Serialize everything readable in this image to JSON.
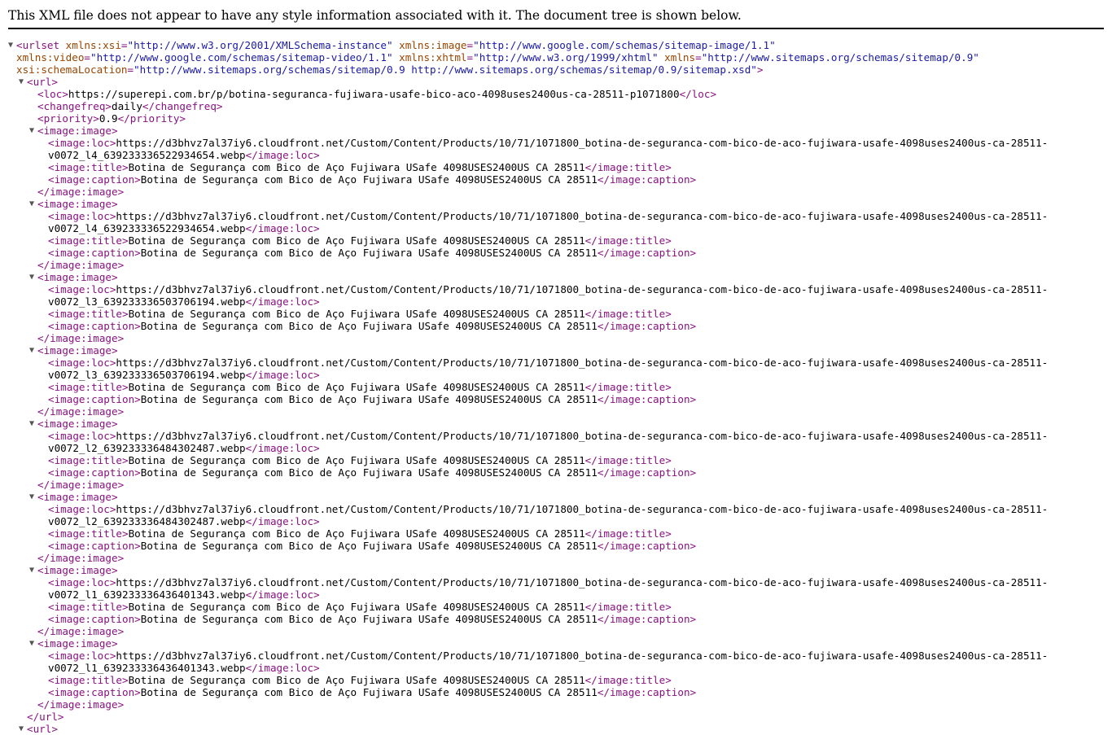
{
  "header": {
    "notice": "This XML file does not appear to have any style information associated with it. The document tree is shown below."
  },
  "icons": {
    "expanded": "▼",
    "expanded_icon_name": "disclosure-triangle-down-icon"
  },
  "colors": {
    "tag": "#881280",
    "attr_name": "#994500",
    "attr_value": "#1a1aa6",
    "text": "#000000"
  },
  "tree": {
    "urlset_open": {
      "tag": "<urlset",
      "attrs": [
        {
          "name": " xmlns:xsi",
          "eq": "=",
          "value": "\"http://www.w3.org/2001/XMLSchema-instance\""
        },
        {
          "name": " xmlns:image",
          "eq": "=",
          "value": "\"http://www.google.com/schemas/sitemap-image/1.1\""
        },
        {
          "name": "xmlns:video",
          "eq": "=",
          "value": "\"http://www.google.com/schemas/sitemap-video/1.1\""
        },
        {
          "name": " xmlns:xhtml",
          "eq": "=",
          "value": "\"http://www.w3.org/1999/xhtml\""
        },
        {
          "name": " xmlns",
          "eq": "=",
          "value": "\"http://www.sitemaps.org/schemas/sitemap/0.9\""
        },
        {
          "name": "xsi:schemaLocation",
          "eq": "=",
          "value": "\"http://www.sitemaps.org/schemas/sitemap/0.9 http://www.sitemaps.org/schemas/sitemap/0.9/sitemap.xsd\""
        }
      ],
      "close": ">"
    },
    "url_open": "<url>",
    "url_close": "</url>",
    "loc": {
      "open": "<loc>",
      "value": "https://superepi.com.br/p/botina-seguranca-fujiwara-usafe-bico-aco-4098uses2400us-ca-28511-p1071800",
      "close": "</loc>"
    },
    "changefreq": {
      "open": "<changefreq>",
      "value": "daily",
      "close": "</changefreq>"
    },
    "priority": {
      "open": "<priority>",
      "value": "0.9",
      "close": "</priority>"
    },
    "image_tags": {
      "open": "<image:image>",
      "close": "</image:image>",
      "loc_open": "<image:loc>",
      "loc_close": "</image:loc>",
      "title_open": "<image:title>",
      "title_close": "</image:title>",
      "caption_open": "<image:caption>",
      "caption_close": "</image:caption>"
    },
    "images": [
      {
        "loc_1": "https://d3bhvz7al37iy6.cloudfront.net/Custom/Content/Products/10/71/1071800_botina-de-seguranca-com-bico-de-aco-fujiwara-usafe-4098uses2400us-ca-28511-",
        "loc_2": "v0072_l4_639233336522934654.webp",
        "title": "Botina de Segurança com Bico de Aço Fujiwara USafe 4098USES2400US CA 28511",
        "caption": "Botina de Segurança com Bico de Aço Fujiwara USafe 4098USES2400US CA 28511"
      },
      {
        "loc_1": "https://d3bhvz7al37iy6.cloudfront.net/Custom/Content/Products/10/71/1071800_botina-de-seguranca-com-bico-de-aco-fujiwara-usafe-4098uses2400us-ca-28511-",
        "loc_2": "v0072_l4_639233336522934654.webp",
        "title": "Botina de Segurança com Bico de Aço Fujiwara USafe 4098USES2400US CA 28511",
        "caption": "Botina de Segurança com Bico de Aço Fujiwara USafe 4098USES2400US CA 28511"
      },
      {
        "loc_1": "https://d3bhvz7al37iy6.cloudfront.net/Custom/Content/Products/10/71/1071800_botina-de-seguranca-com-bico-de-aco-fujiwara-usafe-4098uses2400us-ca-28511-",
        "loc_2": "v0072_l3_639233336503706194.webp",
        "title": "Botina de Segurança com Bico de Aço Fujiwara USafe 4098USES2400US CA 28511",
        "caption": "Botina de Segurança com Bico de Aço Fujiwara USafe 4098USES2400US CA 28511"
      },
      {
        "loc_1": "https://d3bhvz7al37iy6.cloudfront.net/Custom/Content/Products/10/71/1071800_botina-de-seguranca-com-bico-de-aco-fujiwara-usafe-4098uses2400us-ca-28511-",
        "loc_2": "v0072_l3_639233336503706194.webp",
        "title": "Botina de Segurança com Bico de Aço Fujiwara USafe 4098USES2400US CA 28511",
        "caption": "Botina de Segurança com Bico de Aço Fujiwara USafe 4098USES2400US CA 28511"
      },
      {
        "loc_1": "https://d3bhvz7al37iy6.cloudfront.net/Custom/Content/Products/10/71/1071800_botina-de-seguranca-com-bico-de-aco-fujiwara-usafe-4098uses2400us-ca-28511-",
        "loc_2": "v0072_l2_639233336484302487.webp",
        "title": "Botina de Segurança com Bico de Aço Fujiwara USafe 4098USES2400US CA 28511",
        "caption": "Botina de Segurança com Bico de Aço Fujiwara USafe 4098USES2400US CA 28511"
      },
      {
        "loc_1": "https://d3bhvz7al37iy6.cloudfront.net/Custom/Content/Products/10/71/1071800_botina-de-seguranca-com-bico-de-aco-fujiwara-usafe-4098uses2400us-ca-28511-",
        "loc_2": "v0072_l2_639233336484302487.webp",
        "title": "Botina de Segurança com Bico de Aço Fujiwara USafe 4098USES2400US CA 28511",
        "caption": "Botina de Segurança com Bico de Aço Fujiwara USafe 4098USES2400US CA 28511"
      },
      {
        "loc_1": "https://d3bhvz7al37iy6.cloudfront.net/Custom/Content/Products/10/71/1071800_botina-de-seguranca-com-bico-de-aco-fujiwara-usafe-4098uses2400us-ca-28511-",
        "loc_2": "v0072_l1_639233336436401343.webp",
        "title": "Botina de Segurança com Bico de Aço Fujiwara USafe 4098USES2400US CA 28511",
        "caption": "Botina de Segurança com Bico de Aço Fujiwara USafe 4098USES2400US CA 28511"
      },
      {
        "loc_1": "https://d3bhvz7al37iy6.cloudfront.net/Custom/Content/Products/10/71/1071800_botina-de-seguranca-com-bico-de-aco-fujiwara-usafe-4098uses2400us-ca-28511-",
        "loc_2": "v0072_l1_639233336436401343.webp",
        "title": "Botina de Segurança com Bico de Aço Fujiwara USafe 4098USES2400US CA 28511",
        "caption": "Botina de Segurança com Bico de Aço Fujiwara USafe 4098USES2400US CA 28511"
      }
    ]
  }
}
